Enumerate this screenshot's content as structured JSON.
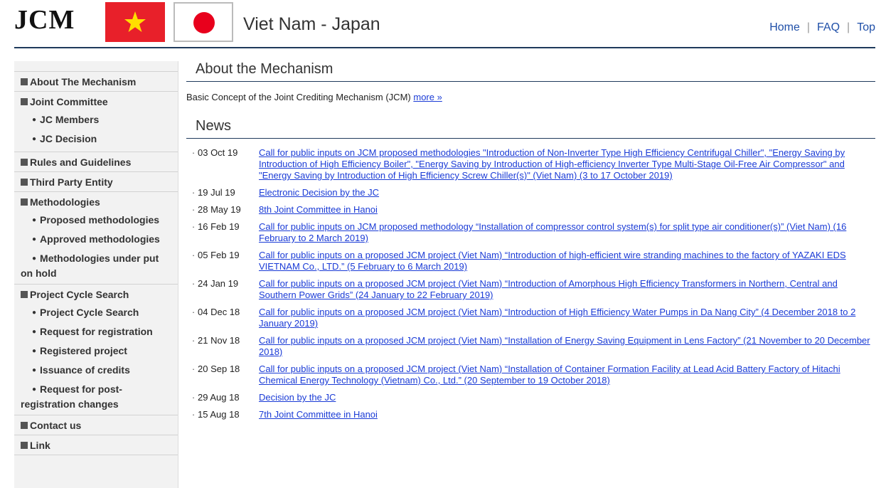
{
  "header": {
    "logo": "JCM",
    "site_title": "Viet Nam - Japan",
    "nav": [
      "Home",
      "FAQ",
      "Top"
    ]
  },
  "sidebar": {
    "items": [
      {
        "label": "About The Mechanism",
        "sub": []
      },
      {
        "label": "Joint Committee",
        "sub": [
          "JC Members",
          "JC Decision"
        ]
      },
      {
        "label": "Rules and Guidelines",
        "sub": []
      },
      {
        "label": "Third Party Entity",
        "sub": []
      },
      {
        "label": "Methodologies",
        "sub": [
          "Proposed methodologies",
          "Approved methodologies",
          "Methodologies under put on hold"
        ]
      },
      {
        "label": "Project Cycle Search",
        "sub": [
          "Project Cycle Search",
          "Request for registration",
          "Registered project",
          "Issuance of credits",
          "Request for post-registration changes"
        ]
      },
      {
        "label": "Contact us",
        "sub": []
      },
      {
        "label": "Link",
        "sub": []
      }
    ]
  },
  "main": {
    "about_title": "About the Mechanism",
    "intro_text": "Basic Concept of the Joint Crediting Mechanism (JCM)",
    "intro_link": "more »",
    "news_title": "News",
    "news": [
      {
        "date": "03 Oct 19",
        "text": "Call for public inputs on JCM proposed methodologies \"Introduction of Non-Inverter Type High Efficiency Centrifugal Chiller\", \"Energy Saving by Introduction of High Efficiency Boiler\", \"Energy Saving by Introduction of High-efficiency Inverter Type Multi-Stage Oil-Free Air Compressor\" and \"Energy Saving by Introduction of High Efficiency Screw Chiller(s)\" (Viet Nam) (3 to 17 October 2019)"
      },
      {
        "date": "19 Jul 19",
        "text": "Electronic Decision by the JC"
      },
      {
        "date": "28 May 19",
        "text": "8th Joint Committee in Hanoi"
      },
      {
        "date": "16 Feb 19",
        "text": "Call for public inputs on JCM proposed methodology “Installation of compressor control system(s) for split type air conditioner(s)” (Viet Nam) (16 February to 2 March 2019)"
      },
      {
        "date": "05 Feb 19",
        "text": "Call for public inputs on a proposed JCM project (Viet Nam) “Introduction of high-efficient wire stranding machines to the factory of YAZAKI EDS VIETNAM Co., LTD.” (5 February to 6 March 2019)"
      },
      {
        "date": "24 Jan 19",
        "text": "Call for public inputs on a proposed JCM project (Viet Nam) “Introduction of Amorphous High Efficiency Transformers in Northern, Central and Southern Power Grids” (24 January to 22 February 2019)"
      },
      {
        "date": "04 Dec 18",
        "text": "Call for public inputs on a proposed JCM project (Viet Nam) “Introduction of High Efficiency Water Pumps in Da Nang City” (4 December 2018 to 2 January 2019)"
      },
      {
        "date": "21 Nov 18",
        "text": "Call for public inputs on a proposed JCM project (Viet Nam) “Installation of Energy Saving Equipment in Lens Factory” (21 November to 20 December 2018)"
      },
      {
        "date": "20 Sep 18",
        "text": "Call for public inputs on a proposed JCM project (Viet Nam) “Installation of Container Formation Facility at Lead Acid Battery Factory of Hitachi Chemical Energy Technology (Vietnam) Co., Ltd.” (20 September to 19 October 2018)"
      },
      {
        "date": "29 Aug 18",
        "text": "Decision by the JC"
      },
      {
        "date": "15 Aug 18",
        "text": "7th Joint Committee in Hanoi"
      }
    ]
  }
}
